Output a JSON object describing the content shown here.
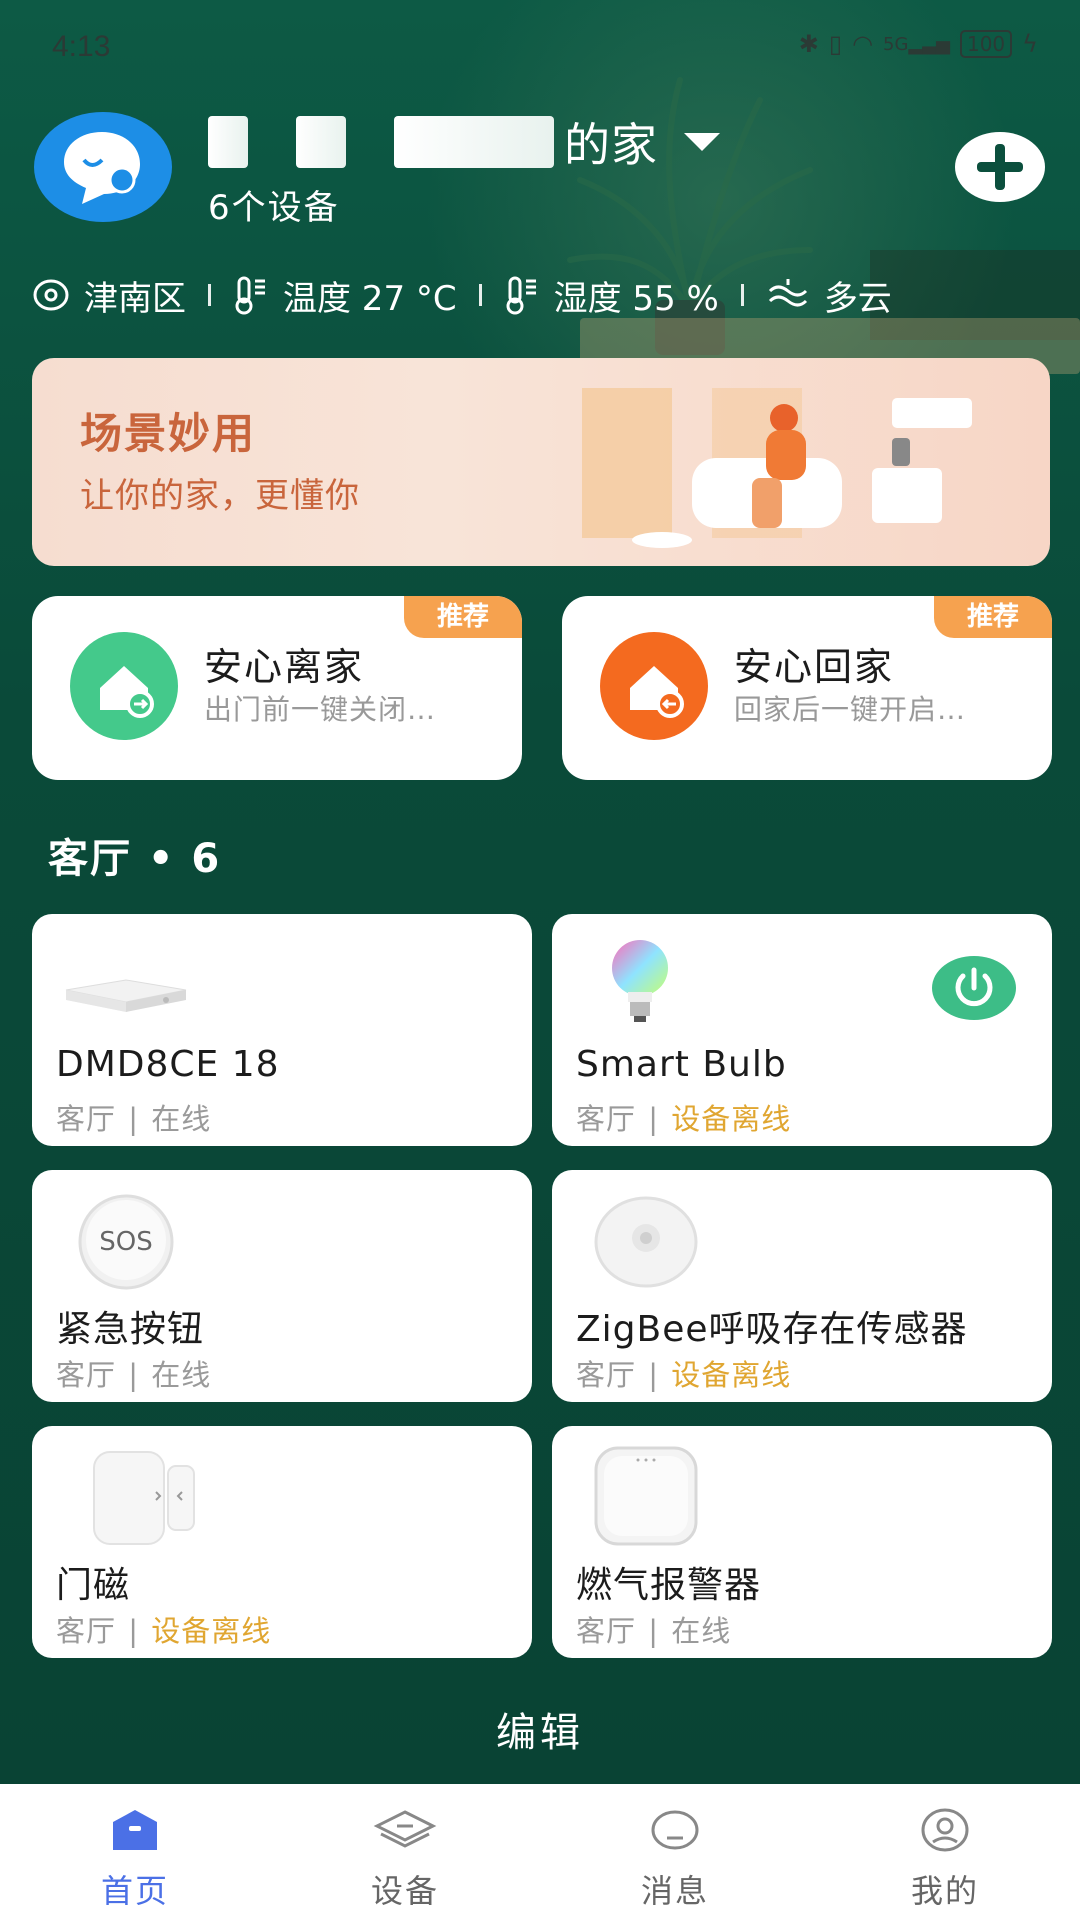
{
  "status_bar": {
    "time": "4:13",
    "network": "5G",
    "battery": "100"
  },
  "header": {
    "home_name": "的家",
    "device_count": "6个设备"
  },
  "weather": {
    "district": "津南区",
    "temperature": "温度 27 °C",
    "humidity": "湿度 55 %",
    "condition": "多云"
  },
  "banner": {
    "title": "场景妙用",
    "subtitle": "让你的家，更懂你"
  },
  "scenes": [
    {
      "title": "安心离家",
      "subtitle": "出门前一键关闭…",
      "tag": "推荐",
      "color": "#44c98b"
    },
    {
      "title": "安心回家",
      "subtitle": "回家后一键开启…",
      "tag": "推荐",
      "color": "#f46a1f"
    }
  ],
  "room": {
    "title": "客厅 • 6"
  },
  "devices": [
    {
      "name": "DMD8CE 18",
      "room": "客厅",
      "status": "在线",
      "offline": false
    },
    {
      "name": "Smart Bulb",
      "room": "客厅",
      "status": "设备离线",
      "offline": true
    },
    {
      "name": "紧急按钮",
      "room": "客厅",
      "status": "在线",
      "offline": false,
      "icon_text": "SOS"
    },
    {
      "name": "ZigBee呼吸存在传感器",
      "room": "客厅",
      "status": "设备离线",
      "offline": true
    },
    {
      "name": "门磁",
      "room": "客厅",
      "status": "设备离线",
      "offline": true
    },
    {
      "name": "燃气报警器",
      "room": "客厅",
      "status": "在线",
      "offline": false
    }
  ],
  "edit_label": "编辑",
  "bottom_nav": [
    {
      "label": "首页",
      "icon": "home-icon",
      "active": true
    },
    {
      "label": "设备",
      "icon": "layers-icon",
      "active": false
    },
    {
      "label": "消息",
      "icon": "message-icon",
      "active": false
    },
    {
      "label": "我的",
      "icon": "profile-icon",
      "active": false
    }
  ],
  "colors": {
    "background": "#0b4f3d",
    "offline": "#e0a631",
    "tag": "#f6a24f",
    "active_tab": "#4b70e6",
    "power_button": "#3dbd87"
  }
}
